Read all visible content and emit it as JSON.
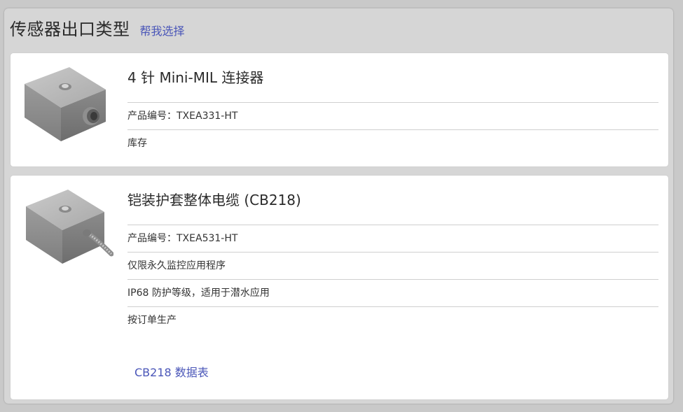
{
  "header": {
    "title": "传感器出口类型",
    "help_link": "帮我选择"
  },
  "products": [
    {
      "image_icon": "sensor-connector-icon",
      "title": "4 针 Mini-MIL 连接器",
      "specs": [
        "产品编号：TXEA331-HT",
        "库存"
      ]
    },
    {
      "image_icon": "sensor-cable-icon",
      "title": "铠装护套整体电缆 (CB218)",
      "specs": [
        "产品编号：TXEA531-HT",
        "仅限永久监控应用程序",
        "IP68 防护等级，适用于潜水应用",
        "按订单生产"
      ],
      "datasheet_link": "CB218 数据表"
    }
  ],
  "colors": {
    "link": "#4a56b8",
    "panel": "#d6d6d6",
    "card": "#ffffff",
    "text": "#2a2a2a"
  }
}
